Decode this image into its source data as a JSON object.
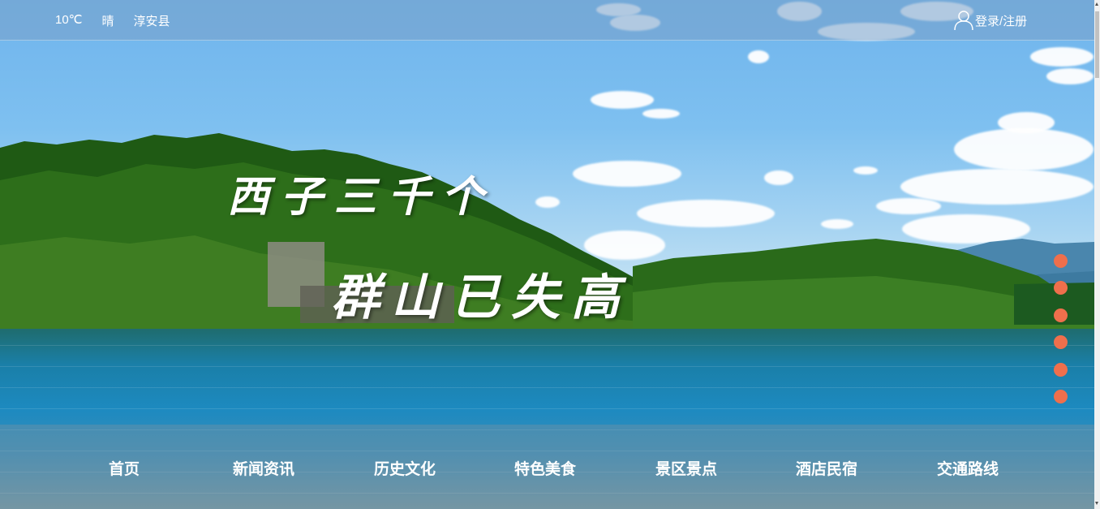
{
  "topbar": {
    "temperature": "10℃",
    "weather": "晴",
    "location": "淳安县",
    "login_label": "登录/注册",
    "login_icon": "user-icon"
  },
  "hero": {
    "line1": "西子三千个",
    "line2": "群山已失高"
  },
  "carousel": {
    "dot_count": 6,
    "dot_color": "#ef6f4c"
  },
  "nav": {
    "items": [
      {
        "label": "首页"
      },
      {
        "label": "新闻资讯"
      },
      {
        "label": "历史文化"
      },
      {
        "label": "特色美食"
      },
      {
        "label": "景区景点"
      },
      {
        "label": "酒店民宿"
      },
      {
        "label": "交通路线"
      }
    ]
  }
}
